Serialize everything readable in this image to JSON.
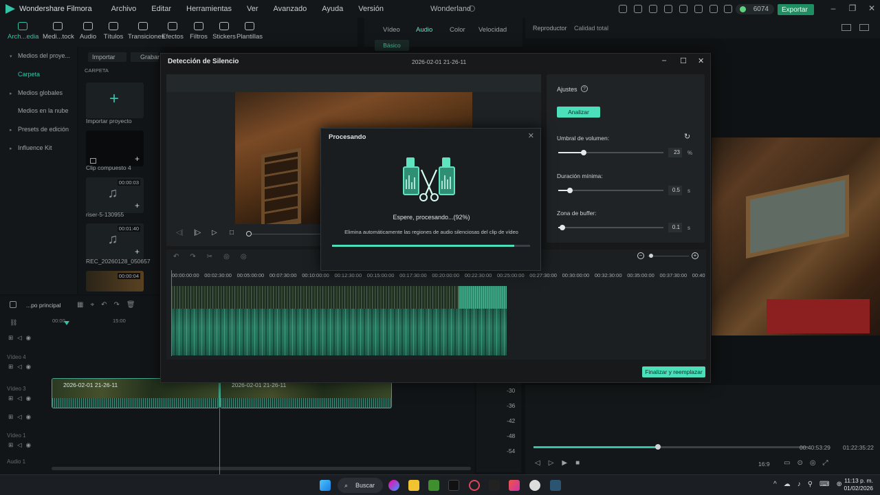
{
  "app": {
    "name": "Wondershare Filmora",
    "menu": [
      "Archivo",
      "Editar",
      "Herramientas",
      "Ver",
      "Avanzado",
      "Ayuda",
      "Versión"
    ],
    "project": "Wonderland",
    "credits": "6074",
    "export_label": "Exportar"
  },
  "toolbar": {
    "items": [
      "Arch...edia",
      "Medi...tock",
      "Audio",
      "Títulos",
      "Transiciones",
      "Efectos",
      "Filtros",
      "Stickers",
      "Plantillas"
    ]
  },
  "property_tabs": [
    "Vídeo",
    "Audio",
    "Color",
    "Velocidad"
  ],
  "basico_label": "Básico",
  "player": {
    "label": "Reproductor",
    "quality": "Calidad total",
    "time_current": "00:40:53:29",
    "time_total": "01:22:35:22",
    "aspect": "16:9"
  },
  "sidebar": {
    "items": [
      "Medios del proye...",
      "Carpeta",
      "Medios globales",
      "Medios en la nube",
      "Presets de edición",
      "Influence Kit"
    ]
  },
  "media": {
    "import_btn": "Importar",
    "record_btn": "Grabar",
    "folder_label": "CARPETA",
    "cards": [
      {
        "label": "Importar proyecto",
        "duration": ""
      },
      {
        "label": "Clip compuesto 4",
        "duration": ""
      },
      {
        "label": "riser-5-130955",
        "duration": "00:00:03"
      },
      {
        "label": "REC_20260128_050657",
        "duration": "00:01:40"
      },
      {
        "label": "",
        "duration": "00:00:04"
      }
    ]
  },
  "timeline": {
    "label": "...po principal",
    "tracks": [
      "Vídeo 4",
      "Vídeo 3",
      "Vídeo 1",
      "Audio 1"
    ],
    "ruler_first": "00:00",
    "ruler_second": "15:00",
    "clips": [
      "2026-02-01 21-26-11",
      "2026-02-01 21-26-11"
    ],
    "meter_labels": [
      "-30",
      "-36",
      "-42",
      "-48",
      "-54"
    ]
  },
  "silence_dialog": {
    "title": "Detección de Silencio",
    "clip_name": "2026-02-01 21-26-11",
    "settings_title": "Ajustes",
    "analyze_btn": "Analizar",
    "volume_label": "Umbral de volumen:",
    "volume_value": "23",
    "volume_unit": "%",
    "volume_level": 0.24,
    "min_duration_label": "Duración mínima:",
    "min_duration_value": "0.5",
    "min_duration_unit": "s",
    "min_duration_level": 0.11,
    "buffer_label": "Zona de buffer:",
    "buffer_value": "0.1",
    "buffer_unit": "s",
    "buffer_level": 0.04,
    "ruler": [
      "00:00:00:00",
      "00:02:30:00",
      "00:05:00:00",
      "00:07:30:00",
      "00:10:00:00",
      "00:12:30:00",
      "00:15:00:00",
      "00:17:30:00",
      "00:20:00:00",
      "00:22:30:00",
      "00:25:00:00",
      "00:27:30:00",
      "00:30:00:00",
      "00:32:30:00",
      "00:35:00:00",
      "00:37:30:00",
      "00:40"
    ],
    "finish_btn": "Finalizar y reemplazar"
  },
  "processing_dialog": {
    "title": "Procesando",
    "status": "Espere, procesando...(92%)",
    "description": "Elimina automáticamente las regiones de audio silenciosas del clip de vídeo",
    "progress": 0.92
  },
  "taskbar": {
    "search": "Buscar",
    "time": "11:13 p. m.",
    "date": "01/02/2026"
  },
  "colors": {
    "accent": "#4be0b9",
    "brand": "#35c3a8",
    "playhead": "#e2455a"
  }
}
